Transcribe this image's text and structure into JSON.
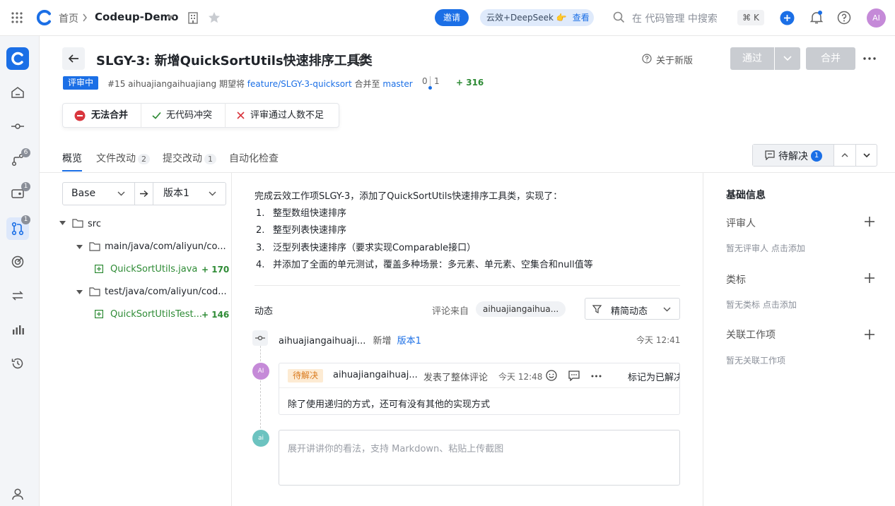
{
  "topbar": {
    "home": "首页",
    "project": "Codeup-Demo",
    "invite": "邀请",
    "ai_pill": "云效+DeepSeek 👉",
    "ai_look": "查看",
    "search_placeholder": "在 代码管理 中搜索",
    "shortcut": "⌘ K",
    "avatar": "AI"
  },
  "rail": {
    "badges": {
      "branches": "6",
      "tags": "1",
      "merge_requests": "1"
    }
  },
  "mr": {
    "title": "SLGY-3: 新增QuickSortUtils快速排序工具类",
    "about_new": "关于新版",
    "approve": "通过",
    "merge": "合并",
    "status": "评审中",
    "meta_prefix": "#15 aihuajiangaihuajiang 期望将",
    "source_branch": "feature/SLGY-3-quicksort",
    "meta_mid": "合并至",
    "target_branch": "master",
    "behind": "0",
    "ahead": "1",
    "lines_added": "+ 316",
    "merge_checks": [
      {
        "label": "无法合并"
      },
      {
        "label": "无代码冲突"
      },
      {
        "label": "评审通过人数不足"
      }
    ]
  },
  "tabs": [
    {
      "label": "概览",
      "count": ""
    },
    {
      "label": "文件改动",
      "count": "2"
    },
    {
      "label": "提交改动",
      "count": "1"
    },
    {
      "label": "自动化检查",
      "count": ""
    }
  ],
  "pending": {
    "label": "待解决",
    "count": "1"
  },
  "filetree": {
    "base": "Base",
    "version": "版本1",
    "root": "src",
    "dirs": [
      {
        "name": "main/java/com/aliyun/co...",
        "file": "QuickSortUtils.java",
        "added": "+ 170"
      },
      {
        "name": "test/java/com/aliyun/cod...",
        "file": "QuickSortUtilsTest...",
        "added": "+ 146"
      }
    ]
  },
  "description": {
    "intro": "完成云效工作项SLGY-3，添加了QuickSortUtils快速排序工具类，实现了：",
    "items": [
      {
        "num": "1.",
        "text": "整型数组快速排序"
      },
      {
        "num": "2.",
        "text": "整型列表快速排序"
      },
      {
        "num": "3.",
        "text": "泛型列表快速排序（要求实现Comparable接口）"
      },
      {
        "num": "4.",
        "text": "并添加了全面的单元测试，覆盖多种场景：多元素、单元素、空集合和null值等"
      }
    ]
  },
  "activity": {
    "title": "动态",
    "comment_from": "评论来自",
    "from_user": "aihuajiangaihua...",
    "filter": "精简动态",
    "event_user": "aihuajiangaihuaji...",
    "event_action": "新增",
    "event_version": "版本1",
    "event_time": "今天 12:41",
    "comment": {
      "avatar": "AI",
      "tag": "待解决",
      "user": "aihuajiangaihuaj...",
      "action": "发表了整体评论",
      "time": "今天 12:48",
      "mark_resolved": "标记为已解决",
      "body": "除了使用递归的方式，还可有没有其他的实现方式"
    },
    "input_avatar": "ai",
    "input_placeholder": "展开讲讲你的看法，支持 Markdown、粘贴上传截图"
  },
  "sidebar": {
    "title": "基础信息",
    "reviewers": "评审人",
    "reviewers_empty": "暂无评审人 点击添加",
    "labels": "类标",
    "labels_empty": "暂无类标 点击添加",
    "workitems": "关联工作项",
    "workitems_empty": "暂无关联工作项"
  },
  "colors": {
    "accent": "#1b6fe6",
    "added": "#2e8b35",
    "pending": "#d97a1d",
    "error": "#d9363e"
  }
}
